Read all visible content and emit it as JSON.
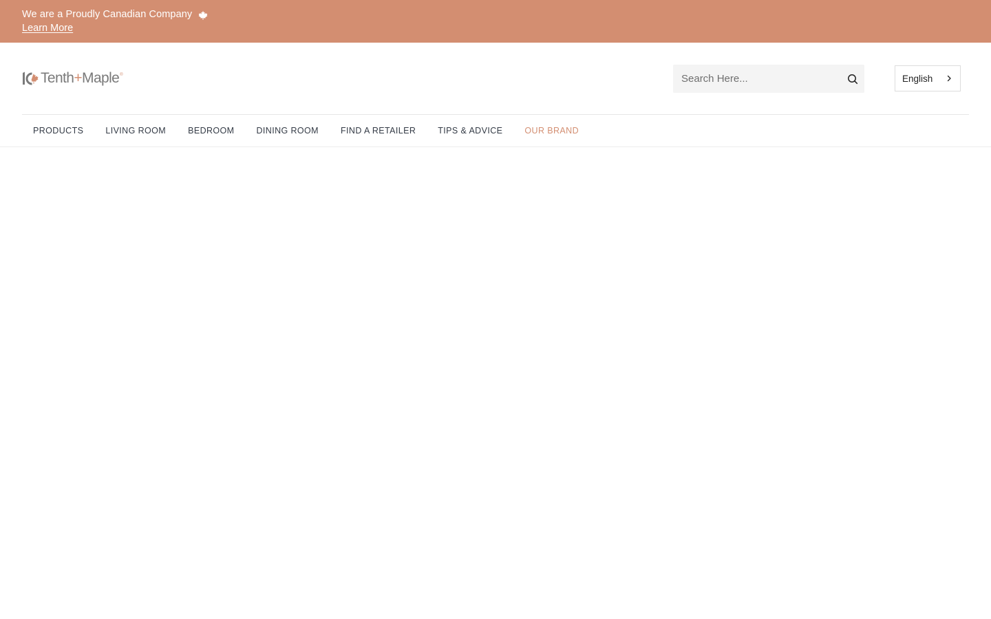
{
  "announcement": {
    "text": "We are a Proudly Canadian Company",
    "icon": "maple-leaf-icon",
    "link_label": "Learn More"
  },
  "header": {
    "logo": {
      "mark": "logo-mark",
      "brand_prefix": "Tenth",
      "brand_plus": "+",
      "brand_suffix": "Maple",
      "trademark": "®"
    },
    "search": {
      "placeholder": "Search Here...",
      "value": "",
      "icon": "search-icon"
    },
    "language": {
      "selected": "English",
      "icon": "chevron-right-icon"
    }
  },
  "nav": {
    "items": [
      {
        "label": "PRODUCTS",
        "active": false
      },
      {
        "label": "LIVING ROOM",
        "active": false
      },
      {
        "label": "BEDROOM",
        "active": false
      },
      {
        "label": "DINING ROOM",
        "active": false
      },
      {
        "label": "FIND A RETAILER",
        "active": false
      },
      {
        "label": "TIPS & ADVICE",
        "active": false
      },
      {
        "label": "OUR BRAND",
        "active": true
      }
    ]
  },
  "colors": {
    "accent": "#d38e71",
    "banner_background": "#d38e71",
    "nav_text": "#333a45",
    "search_background": "#f4f4f4"
  }
}
